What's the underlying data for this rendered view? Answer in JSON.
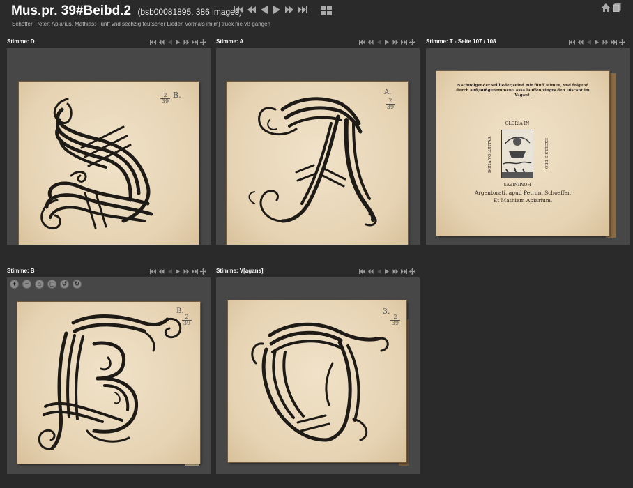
{
  "header": {
    "title": "Mus.pr. 39#Beibd.2",
    "title_suffix": "(bsb00081895, 386 images)",
    "subtitle": "Schöffer, Peter; Apiarius, Mathias: Fünff vnd sechzig teütscher Lieder, vormals im[m] truck nie vß gangen"
  },
  "panels": [
    {
      "label": "Stimme: D",
      "shelfmark_top": "2",
      "shelfmark_bottom": "39",
      "mark": "B."
    },
    {
      "label": "Stimme: A",
      "shelfmark_top": "2",
      "shelfmark_bottom": "39",
      "mark": "A."
    },
    {
      "label": "Stimme: T - Seite 107 / 108"
    },
    {
      "label": "Stimme: B",
      "shelfmark_top": "2",
      "shelfmark_bottom": "39",
      "mark": "B."
    },
    {
      "label": "Stimme: V[agans]",
      "shelfmark_top": "2",
      "shelfmark_bottom": "39",
      "mark": "3."
    }
  ],
  "title_page": {
    "heading": "Nachuolgender sel lieder/seind mit fünff stimen, vnd folgend durch auß/außgenommen/Lassa lauffen/singts den Discant im Vagant.",
    "woodcut_top": "GLORIA IN",
    "woodcut_right": "EXCELSIS DEO.",
    "woodcut_left": "BONA VOLUNTAS.",
    "woodcut_bottom": "HOMINIBVS",
    "imprint_1": "Argentorati, apud Petrum Schoeffer.",
    "imprint_2": "Et Mathiam Apiarium."
  },
  "icons": {
    "nav": [
      "first-icon",
      "prev-fast-icon",
      "prev-icon",
      "next-icon",
      "next-fast-icon",
      "last-icon"
    ],
    "zoom_tools": [
      "zoom-in-icon",
      "zoom-out-icon",
      "home-view-icon",
      "fullscreen-icon",
      "rotate-left-icon",
      "rotate-right-icon"
    ]
  },
  "colors": {
    "background": "#2a2a2a",
    "panel": "#474747",
    "paper": "#e8d8bc",
    "ink": "#1e1a16"
  }
}
